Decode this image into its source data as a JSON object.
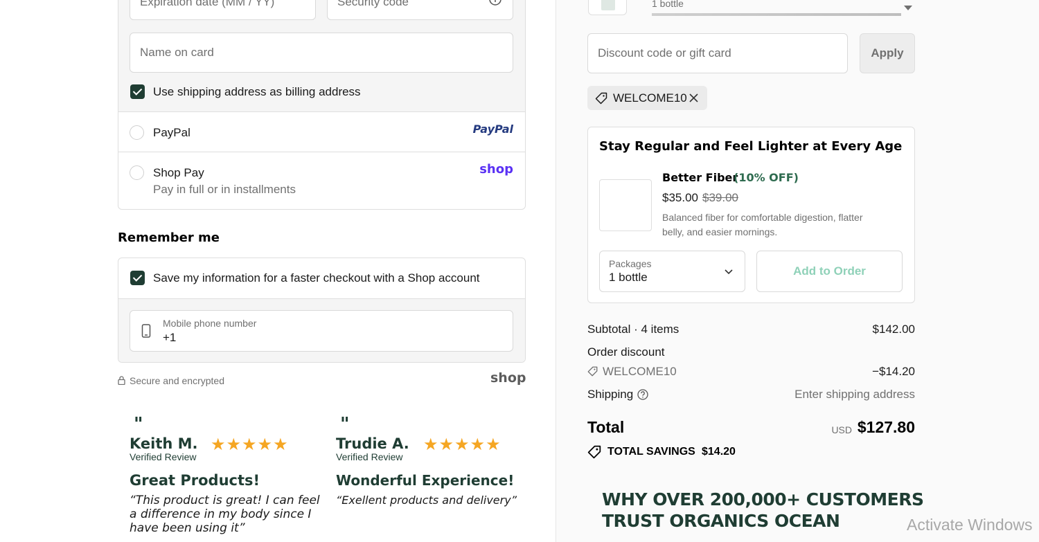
{
  "payment": {
    "expiration_placeholder": "Expiration date (MM / YY)",
    "security_placeholder": "Security code",
    "name_placeholder": "Name on card",
    "billing_checkbox_label": "Use shipping address as billing address",
    "paypal_label": "PayPal",
    "paypal_logo": "PayPal",
    "shoppay_label": "Shop Pay",
    "shoppay_sublabel": "Pay in full or in installments",
    "shop_logo": "shop"
  },
  "remember": {
    "heading": "Remember me",
    "save_label": "Save my information for a faster checkout with a Shop account",
    "phone_label": "Mobile phone number",
    "phone_value": "+1",
    "secure_text": "Secure and encrypted",
    "shop_logo": "shop"
  },
  "reviews": [
    {
      "name": "Keith M.",
      "verified": "Verified Review",
      "stars": "★★★★★",
      "title": "Great Products!",
      "text_lines": [
        "“This product is great! I can feel",
        "a difference in my body since I",
        "have been using it”"
      ]
    },
    {
      "name": "Trudie A.",
      "verified": "Verified Review",
      "stars": "★★★★★",
      "title": "Wonderful Experience!",
      "text_lines": [
        "“Exellent products and delivery”"
      ]
    }
  ],
  "summary": {
    "top_item_text": "1 bottle",
    "discount_placeholder": "Discount code or gift card",
    "apply_label": "Apply",
    "applied_code": "WELCOME10",
    "upsell": {
      "heading": "Stay Regular and Feel Lighter at Every Age",
      "product_name": "Better Fiber",
      "discount_badge": "(10% OFF)",
      "price": "$35.00",
      "compare_price": "$39.00",
      "description_lines": [
        "Balanced fiber for comfortable digestion, flatter",
        "belly, and easier mornings."
      ],
      "packages_label": "Packages",
      "packages_value": "1 bottle",
      "add_button": "Add to Order"
    },
    "subtotal_label": "Subtotal · 4 items",
    "subtotal_value": "$142.00",
    "order_discount_label": "Order discount",
    "discount_code": "WELCOME10",
    "discount_value": "−$14.20",
    "shipping_label": "Shipping",
    "shipping_value": "Enter shipping address",
    "total_label": "Total",
    "currency": "USD",
    "total_value": "$127.80",
    "savings_label": "TOTAL SAVINGS",
    "savings_value": "$14.20",
    "trust_heading_line1": "WHY OVER 200,000+ CUSTOMERS",
    "trust_heading_line2": "TRUST ORGANICS OCEAN"
  },
  "watermark": "Activate Windows",
  "colors": {
    "brand_green": "#1f3d33",
    "star_gold": "#f5a623",
    "paypal_blue": "#253b80",
    "shop_purple": "#5a31f4",
    "add_button_text": "#8fd1b8"
  }
}
